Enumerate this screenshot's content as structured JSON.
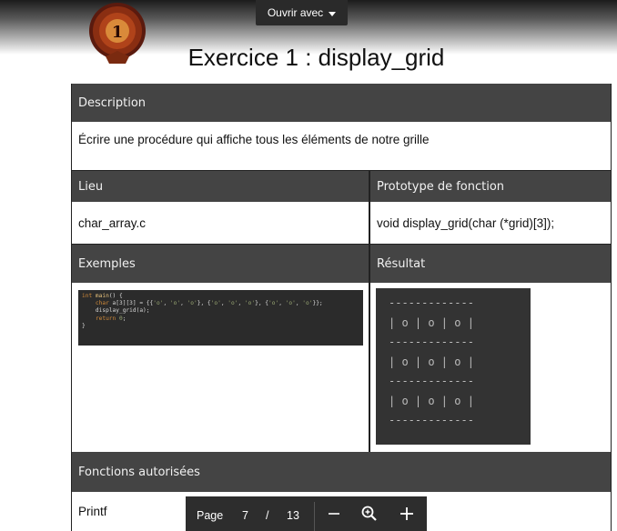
{
  "toolbar": {
    "open_with_label": "Ouvrir avec"
  },
  "header": {
    "title": "Exercice 1 : display_grid"
  },
  "description": {
    "header": "Description",
    "text": "Écrire une procédure qui affiche tous les éléments de notre grille"
  },
  "location": {
    "lieu_header": "Lieu",
    "lieu_value": "char_array.c",
    "proto_header": "Prototype de fonction",
    "proto_value": "void display_grid(char (*grid)[3]);"
  },
  "examples": {
    "header": "Exemples",
    "result_header": "Résultat",
    "code_lines": [
      "int main() {",
      "    char a[3][3] = {{'o', 'o', 'o'}, {'o', 'o', 'o'}, {'o', 'o', 'o'}};",
      "    display_grid(a);",
      "    return 0;",
      "}"
    ],
    "result_lines": [
      "-------------",
      "| o | o | o |",
      "-------------",
      "| o | o | o |",
      "-------------",
      "| o | o | o |",
      "-------------"
    ]
  },
  "allowed": {
    "header": "Fonctions autorisées",
    "value": "Printf"
  },
  "pager": {
    "page_label": "Page",
    "current": "7",
    "separator": "/",
    "total": "13"
  },
  "icons": [
    "caret-down-icon",
    "badge-logo",
    "minus-icon",
    "zoom-icon",
    "plus-icon"
  ]
}
